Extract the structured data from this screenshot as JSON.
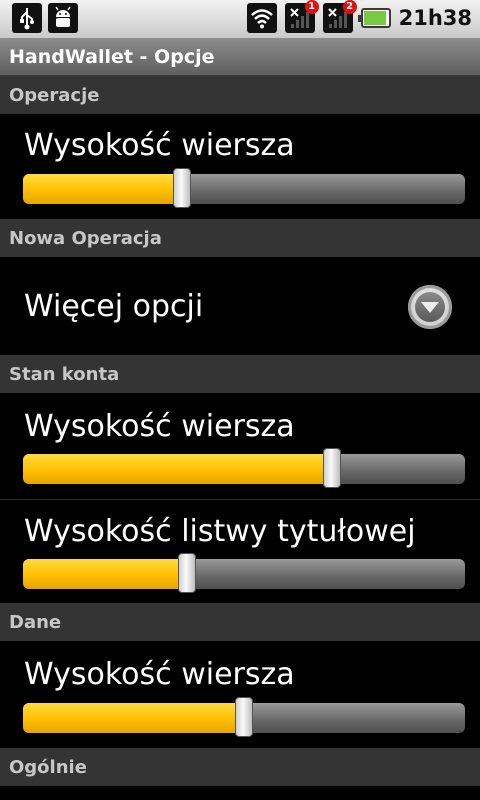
{
  "status_bar": {
    "time": "21h38",
    "left_icons": [
      "usb-icon",
      "android-debug-icon"
    ],
    "right_icons": [
      "wifi-icon",
      "signal-icon",
      "signal-icon",
      "battery-icon"
    ],
    "signal_badges": [
      "1",
      "2"
    ],
    "battery_level": 0.92
  },
  "title_bar": {
    "title": "HandWallet - Opcje"
  },
  "sections": {
    "operacje": {
      "header": "Operacje",
      "row_height": {
        "label": "Wysokość wiersza",
        "value": 0.36
      }
    },
    "nowa_operacja": {
      "header": "Nowa Operacja",
      "more_options": {
        "label": "Więcej opcji",
        "icon": "chevron-down-circle-icon"
      }
    },
    "stan_konta": {
      "header": "Stan konta",
      "row_height": {
        "label": "Wysokość wiersza",
        "value": 0.7
      },
      "title_bar_height": {
        "label": "Wysokość listwy tytułowej",
        "value": 0.37
      }
    },
    "dane": {
      "header": "Dane",
      "row_height": {
        "label": "Wysokość wiersza",
        "value": 0.5
      }
    },
    "ogolnie": {
      "header": "Ogólnie"
    }
  },
  "colors": {
    "slider_fill": "#ffbf00",
    "section_header_bg": "#343434",
    "background": "#000000"
  }
}
